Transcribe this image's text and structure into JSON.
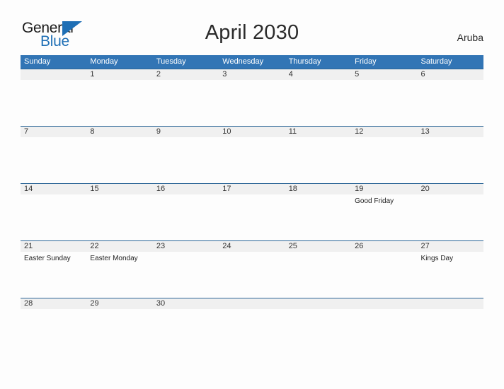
{
  "brand": {
    "name_part1": "General",
    "name_part2": "Blue",
    "accent_color": "#1f6fb5"
  },
  "header": {
    "title": "April 2030",
    "region": "Aruba"
  },
  "calendar": {
    "header_bg": "#3275b5",
    "band_bg": "#f0f0f0",
    "rule_color": "#2a6496",
    "weekdays": [
      "Sunday",
      "Monday",
      "Tuesday",
      "Wednesday",
      "Thursday",
      "Friday",
      "Saturday"
    ],
    "weeks": [
      [
        {
          "day": ""
        },
        {
          "day": "1"
        },
        {
          "day": "2"
        },
        {
          "day": "3"
        },
        {
          "day": "4"
        },
        {
          "day": "5"
        },
        {
          "day": "6"
        }
      ],
      [
        {
          "day": "7"
        },
        {
          "day": "8"
        },
        {
          "day": "9"
        },
        {
          "day": "10"
        },
        {
          "day": "11"
        },
        {
          "day": "12"
        },
        {
          "day": "13"
        }
      ],
      [
        {
          "day": "14"
        },
        {
          "day": "15"
        },
        {
          "day": "16"
        },
        {
          "day": "17"
        },
        {
          "day": "18"
        },
        {
          "day": "19",
          "event": "Good Friday"
        },
        {
          "day": "20"
        }
      ],
      [
        {
          "day": "21",
          "event": "Easter Sunday"
        },
        {
          "day": "22",
          "event": "Easter Monday"
        },
        {
          "day": "23"
        },
        {
          "day": "24"
        },
        {
          "day": "25"
        },
        {
          "day": "26"
        },
        {
          "day": "27",
          "event": "Kings Day"
        }
      ],
      [
        {
          "day": "28"
        },
        {
          "day": "29"
        },
        {
          "day": "30"
        },
        {
          "day": ""
        },
        {
          "day": ""
        },
        {
          "day": ""
        },
        {
          "day": ""
        }
      ]
    ]
  }
}
